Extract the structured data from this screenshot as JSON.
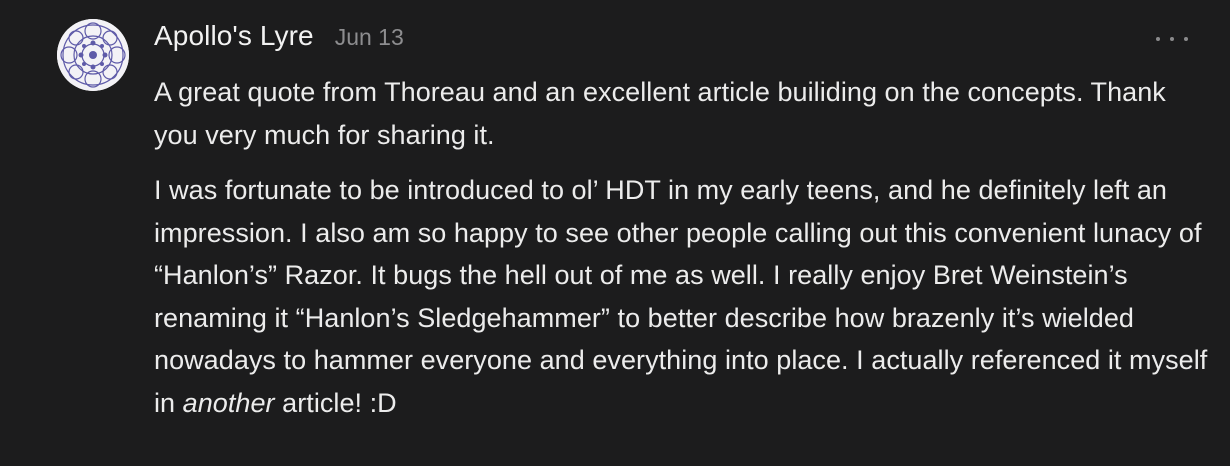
{
  "comment": {
    "author": "Apollo's Lyre",
    "date": "Jun 13",
    "more_icon": "more-horizontal-icon",
    "paragraph_1": "A great quote from Thoreau and an excellent article builiding on the concepts. Thank you very much for sharing it.",
    "paragraph_2_before": "I was fortunate to be introduced to ol’ HDT in my early teens, and he definitely left an impression. I also am so happy to see other people calling out this convenient lunacy of “Hanlon’s” Razor. It bugs the hell out of me as well. I really enjoy Bret Weinstein’s renaming it “Hanlon’s Sledgehammer” to better describe how brazenly it’s wielded nowadays to hammer everyone and everything into place. I actually referenced it myself in ",
    "paragraph_2_emphasis": "another",
    "paragraph_2_after": " article! :D"
  },
  "colors": {
    "background": "#1c1c1d",
    "text": "#ececec",
    "muted": "#8d8d8f",
    "avatar_pattern": "#5e5aa8"
  }
}
